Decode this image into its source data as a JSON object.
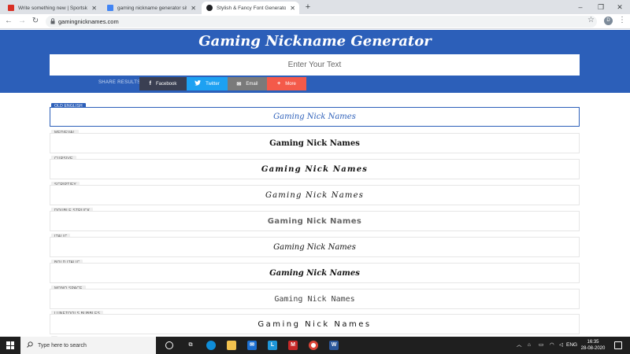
{
  "browser": {
    "tabs": [
      {
        "title": "Write something new | Sportskee",
        "active": false,
        "favicon_color": "#d93025"
      },
      {
        "title": "gaming nickname generator site",
        "active": false,
        "favicon_color": "#4285f4"
      },
      {
        "title": "Stylish & Fancy Font Generator |",
        "active": true,
        "favicon_color": "#202124"
      }
    ],
    "new_tab": "+",
    "url": "gamingnicknames.com",
    "profile_initial": "D",
    "window_controls": [
      "–",
      "❐",
      "✕"
    ]
  },
  "header": {
    "title": "Gaming Nickname Generator",
    "input_placeholder": "Enter Your Text",
    "share_label": "SHARE RESULTS:",
    "share_buttons": [
      {
        "label": "Facebook",
        "icon": "f",
        "color": "#3a3f52"
      },
      {
        "label": "Twitter",
        "icon": "t",
        "color": "#1da1f2"
      },
      {
        "label": "Email",
        "icon": "✉",
        "color": "#7a7a7a"
      },
      {
        "label": "More",
        "icon": "+",
        "color": "#f45a4a"
      }
    ]
  },
  "results": [
    {
      "category": "OLD ENGLISH",
      "text": "Gaming Nick Names",
      "active": true
    },
    {
      "category": "MEDIEVAL",
      "text": "Gaming Nick Names",
      "active": false
    },
    {
      "category": "CURSIVE",
      "text": "Gaming Nick Names",
      "active": false
    },
    {
      "category": "SCRIPTIFY",
      "text": "Gaming Nick Names",
      "active": false
    },
    {
      "category": "DOUBLE STRUCK",
      "text": "Gaming Nick Names",
      "active": false
    },
    {
      "category": "ITALIC",
      "text": "Gaming Nick Names",
      "active": false
    },
    {
      "category": "BOLD ITALIC",
      "text": "Gaming Nick Names",
      "active": false
    },
    {
      "category": "MONO SPACE",
      "text": "Gaming Nick Names",
      "active": false
    },
    {
      "category": "LUNETOOLS BUBBLES",
      "text": "Gaming Nick Names",
      "active": false
    }
  ],
  "taskbar": {
    "search_placeholder": "Type here to search",
    "language": "ENG",
    "time": "16:35",
    "date": "28-08-2020"
  },
  "colors": {
    "brand_blue": "#2c5fb9"
  }
}
